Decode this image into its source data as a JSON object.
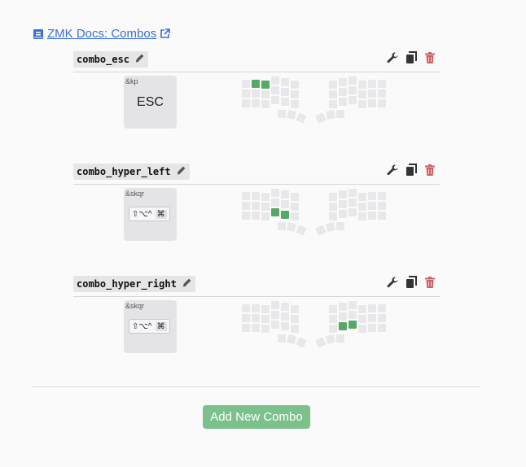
{
  "docs_link": {
    "label": "ZMK Docs: Combos"
  },
  "combos": [
    {
      "name": "combo_esc",
      "behavior": "&kp",
      "param": "ESC",
      "modifiers": "",
      "cmd": "",
      "active_keys": [
        1,
        2
      ]
    },
    {
      "name": "combo_hyper_left",
      "behavior": "&skqr",
      "param": "",
      "modifiers": "⇧⌥^",
      "cmd": "⌘",
      "active_keys": [
        21,
        22
      ]
    },
    {
      "name": "combo_hyper_right",
      "behavior": "&skqr",
      "param": "",
      "modifiers": "⇧⌥^",
      "cmd": "⌘",
      "active_keys": [
        48,
        49
      ]
    }
  ],
  "add_button": {
    "label": "Add New Combo"
  },
  "colors": {
    "link": "#3a6fd8",
    "key_active": "#57a866",
    "key_inactive": "#e8e8ea",
    "add_button": "#7cc18c",
    "delete": "#c86464"
  },
  "icons": {
    "docs": "book-icon",
    "external": "external-link-icon",
    "edit": "pencil-icon",
    "settings": "wrench-icon",
    "duplicate": "copy-icon",
    "delete": "trash-icon"
  }
}
